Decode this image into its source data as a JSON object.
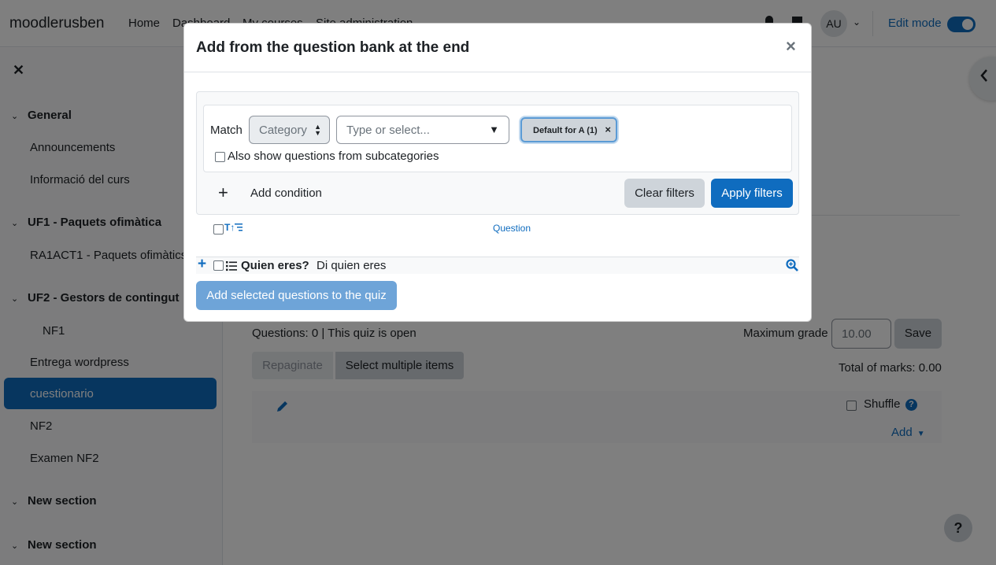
{
  "navbar": {
    "brand": "moodlerusben",
    "links": [
      "Home",
      "Dashboard",
      "My courses",
      "Site administration"
    ],
    "avatar_initials": "AU",
    "edit_mode_label": "Edit mode",
    "edit_mode_on": true
  },
  "drawer": {
    "close_glyph": "✕",
    "sections": [
      {
        "title": "General",
        "items": [
          "Announcements",
          "Informació del curs"
        ]
      },
      {
        "title": "UF1 - Paquets ofimàtica",
        "items": [
          "RA1ACT1 - Paquets ofimàtics"
        ]
      },
      {
        "title": "UF2 - Gestors de contingut",
        "items": [
          "NF1",
          "Entrega wordpress",
          "cuestionario",
          "NF2",
          "Examen NF2"
        ]
      },
      {
        "title": "New section",
        "items": []
      },
      {
        "title": "New section",
        "items": []
      }
    ],
    "active_item": "cuestionario"
  },
  "main": {
    "questions_info": "Questions: 0 | This quiz is open",
    "max_grade_label": "Maximum grade",
    "max_grade_value": "10.00",
    "save_label": "Save",
    "repaginate_label": "Repaginate",
    "select_multiple_label": "Select multiple items",
    "total_marks": "Total of marks: 0.00",
    "shuffle_label": "Shuffle",
    "add_label": "Add",
    "help_glyph": "?"
  },
  "modal": {
    "title": "Add from the question bank at the end",
    "close_glyph": "×",
    "filter": {
      "match_label": "Match",
      "condition_type": "Category",
      "input_placeholder": "Type or select...",
      "selected_chip": "Default for A (1)",
      "subcategories_label": "Also show questions from subcategories",
      "add_condition_label": "Add condition",
      "clear_filters_label": "Clear filters",
      "apply_filters_label": "Apply filters"
    },
    "table": {
      "sort_glyph": "T↑",
      "question_header": "Question",
      "rows": [
        {
          "name": "Quien eres?",
          "text": "Di quien eres"
        }
      ]
    },
    "add_selected_label": "Add selected questions to the quiz"
  },
  "colors": {
    "primary": "#0f6cbf",
    "backdrop": "rgba(0,0,0,0.5)"
  }
}
